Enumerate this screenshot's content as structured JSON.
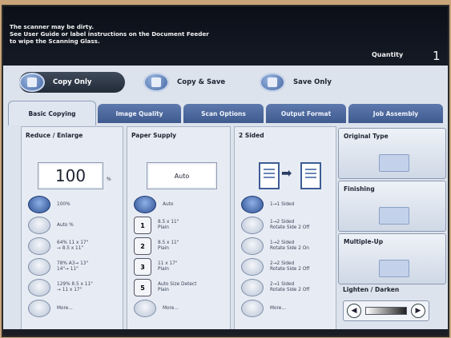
{
  "header": {
    "message_lines": [
      "The scanner may be dirty.",
      "See User Guide or label instructions on the Document Feeder",
      "to wipe the Scanning Glass."
    ],
    "quantity_label": "Quantity",
    "quantity_value": "1"
  },
  "modes": [
    {
      "label": "Copy Only",
      "active": true
    },
    {
      "label": "Copy & Save",
      "active": false
    },
    {
      "label": "Save Only",
      "active": false
    }
  ],
  "tabs": [
    {
      "label": "Basic Copying",
      "active": true
    },
    {
      "label": "Image Quality",
      "active": false
    },
    {
      "label": "Scan Options",
      "active": false
    },
    {
      "label": "Output Format",
      "active": false
    },
    {
      "label": "Job Assembly",
      "active": false
    }
  ],
  "reduce_enlarge": {
    "title": "Reduce / Enlarge",
    "value": "100",
    "unit": "%",
    "options": [
      {
        "label": "100%",
        "selected": true
      },
      {
        "label": "Auto %",
        "selected": false
      },
      {
        "label": "64% 11 x 17\"\n→ 8.5 x 11\"",
        "selected": false
      },
      {
        "label": "78% A3→ 13\"\n14\"→ 11\"",
        "selected": false
      },
      {
        "label": "129% 8.5 x 11\"\n→ 11 x 17\"",
        "selected": false
      },
      {
        "label": "More...",
        "selected": false
      }
    ]
  },
  "paper_supply": {
    "title": "Paper Supply",
    "value": "Auto",
    "options": [
      {
        "tray": "",
        "label": "Auto",
        "selected": true
      },
      {
        "tray": "1",
        "label": "8.5 x 11\"\nPlain",
        "selected": false
      },
      {
        "tray": "2",
        "label": "8.5 x 11\"\nPlain",
        "selected": false
      },
      {
        "tray": "3",
        "label": "11 x 17\"\nPlain",
        "selected": false
      },
      {
        "tray": "5",
        "label": "Auto Size Detect\nPlain",
        "selected": false
      },
      {
        "tray": "",
        "label": "More...",
        "selected": false
      }
    ]
  },
  "two_sided": {
    "title": "2 Sided",
    "options": [
      {
        "label": "1→1 Sided",
        "selected": true
      },
      {
        "label": "1→2 Sided\nRotate Side 2 Off",
        "selected": false
      },
      {
        "label": "1→2 Sided\nRotate Side 2 On",
        "selected": false
      },
      {
        "label": "2→2 Sided\nRotate Side 2 Off",
        "selected": false
      },
      {
        "label": "2→1 Sided\nRotate Side 2 Off",
        "selected": false
      },
      {
        "label": "More...",
        "selected": false
      }
    ]
  },
  "side_buttons": {
    "original_type": "Original Type",
    "finishing": "Finishing",
    "multiple_up": "Multiple-Up",
    "lighten_darken": "Lighten / Darken"
  },
  "icons": {
    "left_arrow": "◀",
    "right_arrow": "▶",
    "right_big_arrow": "➡"
  },
  "colors": {
    "tab_blue": "#4a66a0",
    "selected_radio": "#2c4f92",
    "topbar": "#0b0f18"
  }
}
